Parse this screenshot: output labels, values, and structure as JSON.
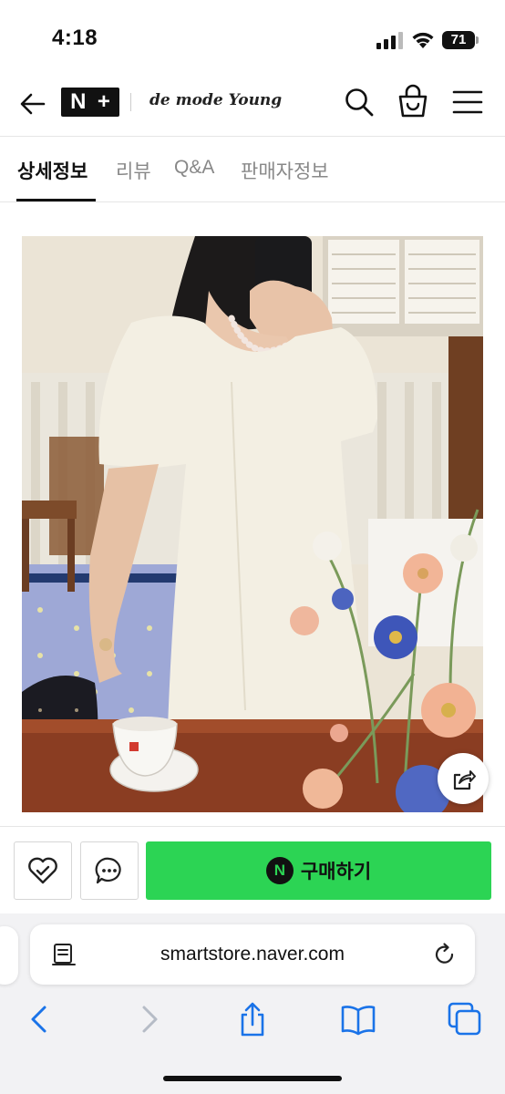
{
  "status_bar": {
    "time": "4:18",
    "battery_level": "71"
  },
  "header": {
    "logo_n": "N",
    "logo_plus": "+",
    "brand_name": "de mode Young"
  },
  "tabs": [
    {
      "label": "상세정보",
      "active": true
    },
    {
      "label": "리뷰",
      "active": false
    },
    {
      "label": "Q&A",
      "active": false
    },
    {
      "label": "판매자정보",
      "active": false
    }
  ],
  "action_bar": {
    "buy_npay_glyph": "N",
    "buy_label": "구매하기",
    "buy_color": "#2cd454"
  },
  "browser": {
    "url": "smartstore.naver.com"
  },
  "icons": {
    "back": "back-arrow-icon",
    "search": "search-icon",
    "cart": "shopping-bag-icon",
    "menu": "hamburger-menu-icon",
    "share": "share-icon",
    "wish": "heart-check-icon",
    "talk": "chat-bubble-icon",
    "reader": "reader-mode-icon",
    "reload": "reload-icon",
    "browser_back": "chevron-left-icon",
    "browser_forward": "chevron-right-icon",
    "browser_share": "share-icon",
    "bookmarks": "book-icon",
    "tabs": "tabs-icon"
  }
}
